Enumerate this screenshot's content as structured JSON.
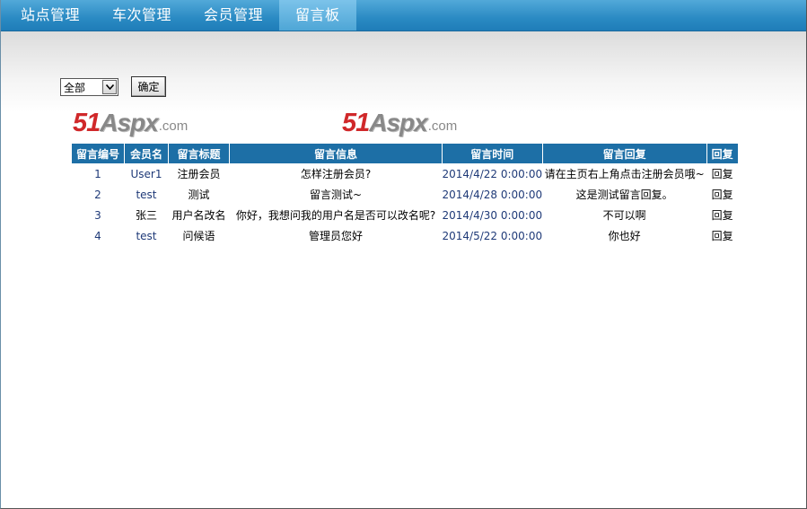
{
  "nav": {
    "items": [
      {
        "label": "站点管理"
      },
      {
        "label": "车次管理"
      },
      {
        "label": "会员管理"
      },
      {
        "label": "留言板"
      }
    ]
  },
  "filter": {
    "selected": "全部",
    "confirm_label": "确定"
  },
  "logos": [
    {
      "num": "51",
      "aspx": "Aspx",
      "com": ".com"
    },
    {
      "num": "51",
      "aspx": "Aspx",
      "com": ".com"
    }
  ],
  "table": {
    "headers": [
      "留言编号",
      "会员名",
      "留言标题",
      "留言信息",
      "留言时间",
      "留言回复",
      "回复"
    ],
    "rows": [
      {
        "id": "1",
        "member": "User1",
        "title": "注册会员",
        "message": "怎样注册会员?",
        "time": "2014/4/22 0:00:00",
        "reply": "请在主页右上角点击注册会员哦~",
        "action": "回复"
      },
      {
        "id": "2",
        "member": "test",
        "title": "测试",
        "message": "留言测试~",
        "time": "2014/4/28 0:00:00",
        "reply": "这是测试留言回复。",
        "action": "回复"
      },
      {
        "id": "3",
        "member": "张三",
        "title": "用户名改名",
        "message": "你好，我想问我的用户名是否可以改名呢?",
        "time": "2014/4/30 0:00:00",
        "reply": "不可以啊",
        "action": "回复"
      },
      {
        "id": "4",
        "member": "test",
        "title": "问候语",
        "message": "管理员您好",
        "time": "2014/5/22 0:00:00",
        "reply": "你也好",
        "action": "回复"
      }
    ]
  },
  "colors": {
    "nav_bar": "#2a8ac3",
    "header_bg": "#1d6fa6",
    "logo_red": "#d0282a",
    "logo_gray": "#888888"
  }
}
